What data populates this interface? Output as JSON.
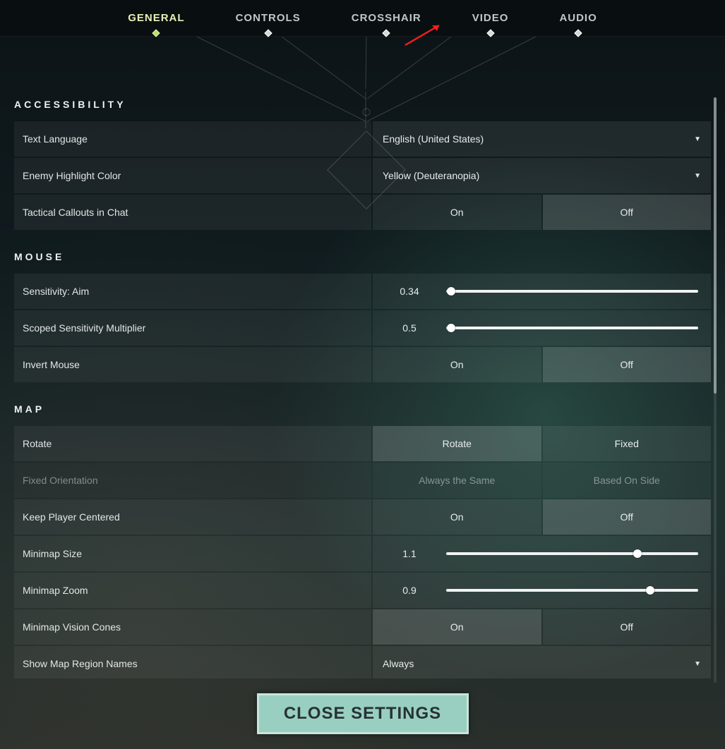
{
  "tabs": [
    "GENERAL",
    "CONTROLS",
    "CROSSHAIR",
    "VIDEO",
    "AUDIO"
  ],
  "active_tab": 0,
  "sections": {
    "accessibility": {
      "title": "ACCESSIBILITY",
      "text_language": {
        "label": "Text Language",
        "value": "English (United States)"
      },
      "enemy_highlight": {
        "label": "Enemy Highlight Color",
        "value": "Yellow (Deuteranopia)"
      },
      "tactical_callouts": {
        "label": "Tactical Callouts in Chat",
        "options": [
          "On",
          "Off"
        ],
        "selected": 1
      }
    },
    "mouse": {
      "title": "MOUSE",
      "sensitivity": {
        "label": "Sensitivity: Aim",
        "value": "0.34",
        "pct": 2
      },
      "scoped_mult": {
        "label": "Scoped Sensitivity Multiplier",
        "value": "0.5",
        "pct": 2
      },
      "invert": {
        "label": "Invert Mouse",
        "options": [
          "On",
          "Off"
        ],
        "selected": 1
      }
    },
    "map": {
      "title": "MAP",
      "rotate": {
        "label": "Rotate",
        "options": [
          "Rotate",
          "Fixed"
        ],
        "selected": 0
      },
      "fixed_orientation": {
        "label": "Fixed Orientation",
        "options": [
          "Always the Same",
          "Based On Side"
        ],
        "selected": -1,
        "disabled": true
      },
      "keep_centered": {
        "label": "Keep Player Centered",
        "options": [
          "On",
          "Off"
        ],
        "selected": 1
      },
      "minimap_size": {
        "label": "Minimap Size",
        "value": "1.1",
        "pct": 76
      },
      "minimap_zoom": {
        "label": "Minimap Zoom",
        "value": "0.9",
        "pct": 81
      },
      "vision_cones": {
        "label": "Minimap Vision Cones",
        "options": [
          "On",
          "Off"
        ],
        "selected": 0
      },
      "region_names": {
        "label": "Show Map Region Names",
        "value": "Always"
      }
    }
  },
  "close_button": "CLOSE SETTINGS"
}
